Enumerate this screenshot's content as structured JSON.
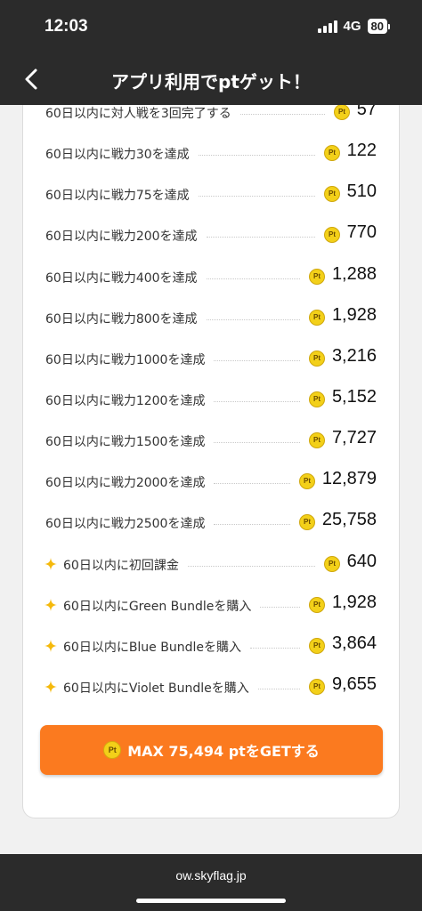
{
  "status": {
    "time": "12:03",
    "network": "4G",
    "battery": "80"
  },
  "header": {
    "title": "アプリ利用でptゲット！",
    "back_icon": "chevron-left-icon"
  },
  "coin_label": "Pt",
  "tasks": [
    {
      "label": "60日以内に対人戦を3回完了する",
      "points": "57",
      "starred": false
    },
    {
      "label": "60日以内に戦力30を達成",
      "points": "122",
      "starred": false
    },
    {
      "label": "60日以内に戦力75を達成",
      "points": "510",
      "starred": false
    },
    {
      "label": "60日以内に戦力200を達成",
      "points": "770",
      "starred": false
    },
    {
      "label": "60日以内に戦力400を達成",
      "points": "1,288",
      "starred": false
    },
    {
      "label": "60日以内に戦力800を達成",
      "points": "1,928",
      "starred": false
    },
    {
      "label": "60日以内に戦力1000を達成",
      "points": "3,216",
      "starred": false
    },
    {
      "label": "60日以内に戦力1200を達成",
      "points": "5,152",
      "starred": false
    },
    {
      "label": "60日以内に戦力1500を達成",
      "points": "7,727",
      "starred": false
    },
    {
      "label": "60日以内に戦力2000を達成",
      "points": "12,879",
      "starred": false
    },
    {
      "label": "60日以内に戦力2500を達成",
      "points": "25,758",
      "starred": false
    },
    {
      "label": "60日以内に初回課金",
      "points": "640",
      "starred": true
    },
    {
      "label": "60日以内にGreen Bundleを購入",
      "points": "1,928",
      "starred": true
    },
    {
      "label": "60日以内にBlue Bundleを購入",
      "points": "3,864",
      "starred": true
    },
    {
      "label": "60日以内にViolet Bundleを購入",
      "points": "9,655",
      "starred": true
    }
  ],
  "cta": {
    "label": "MAX 75,494 ptをGETする"
  },
  "browser": {
    "url": "ow.skyflag.jp"
  },
  "colors": {
    "accent": "#fb7a1f",
    "coin": "#f3d019",
    "star": "#f5b90b",
    "bar": "#2b2b2b"
  }
}
